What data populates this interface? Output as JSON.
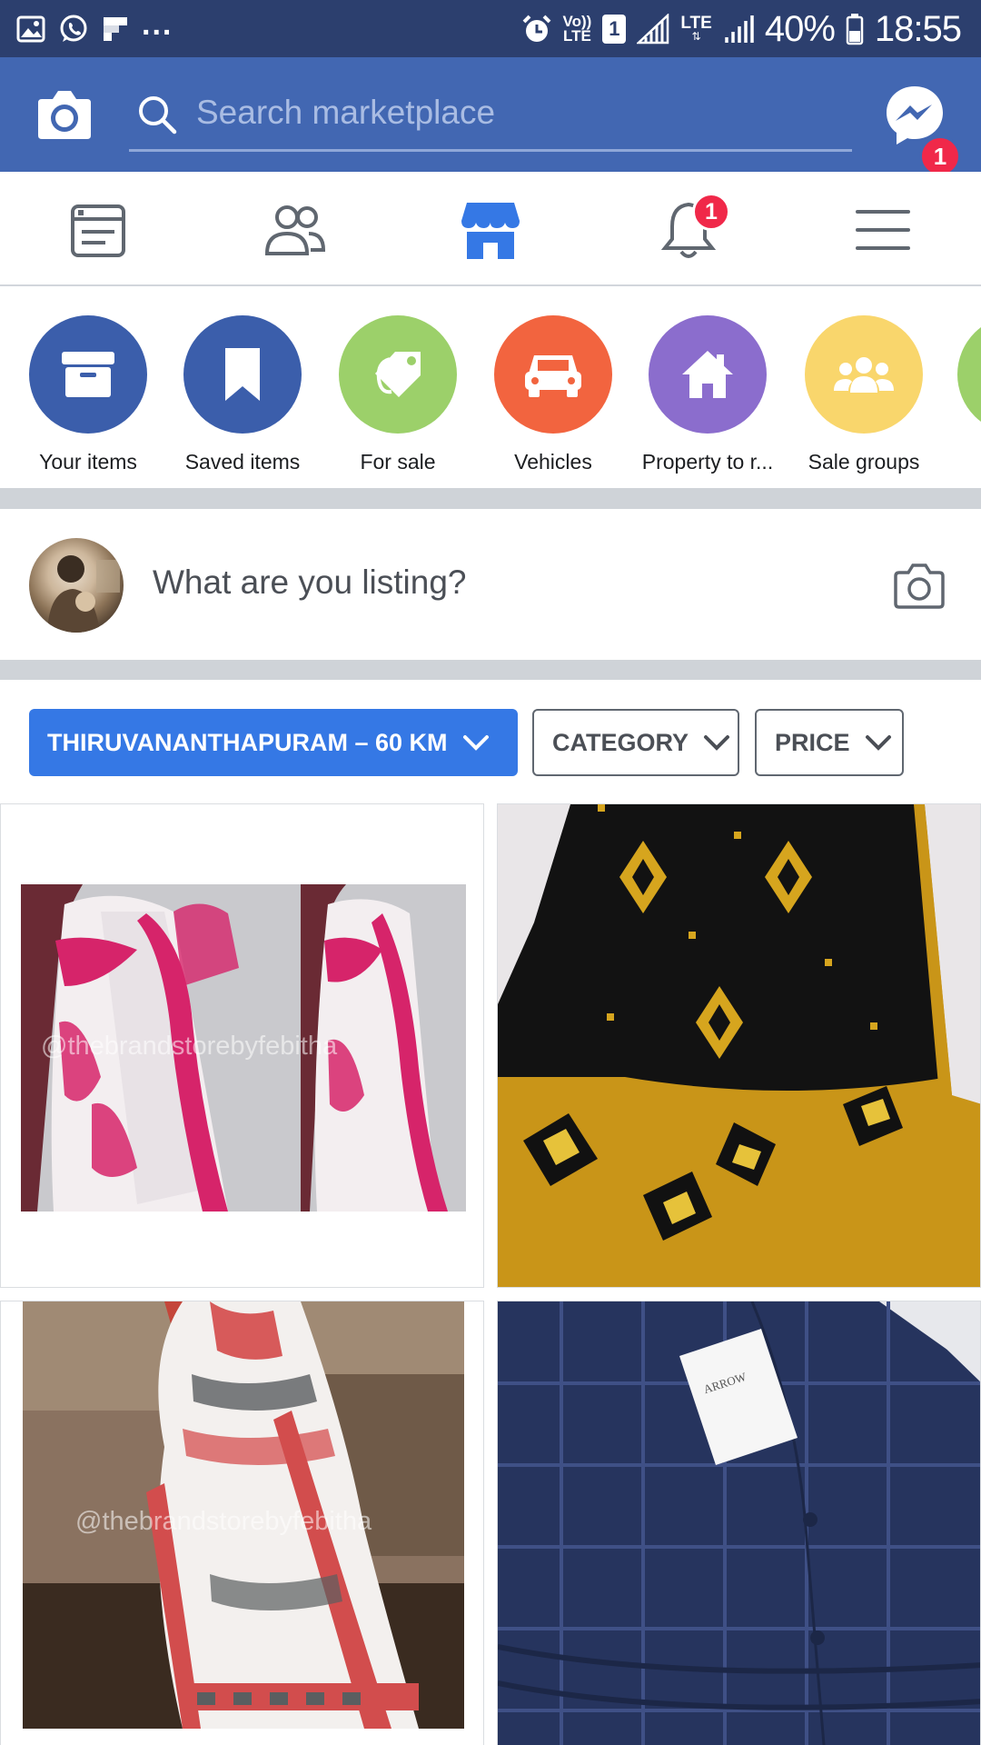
{
  "status_bar": {
    "dots": "...",
    "volte_top": "Vo))",
    "volte_bottom": "LTE",
    "sim": "1",
    "lte": "LTE",
    "battery": "40%",
    "time": "18:55"
  },
  "header": {
    "search_placeholder": "Search marketplace",
    "messenger_badge": "1"
  },
  "nav": {
    "notifications_badge": "1",
    "active_tab": "marketplace"
  },
  "shortcuts": [
    {
      "label": "Your items",
      "color": "#3b5eab",
      "icon": "archive-box-icon"
    },
    {
      "label": "Saved items",
      "color": "#3b5eab",
      "icon": "bookmark-icon"
    },
    {
      "label": "For sale",
      "color": "#9cd06a",
      "icon": "price-tag-icon"
    },
    {
      "label": "Vehicles",
      "color": "#f2643f",
      "icon": "car-icon"
    },
    {
      "label": "Property to r...",
      "color": "#8b6dcd",
      "icon": "house-icon"
    },
    {
      "label": "Sale groups",
      "color": "#f9d66c",
      "icon": "group-icon"
    }
  ],
  "composer": {
    "prompt": "What are you listing?"
  },
  "filters": {
    "location": "THIRUVANANTHAPURAM – 60 KM",
    "category": "CATEGORY",
    "price": "PRICE"
  },
  "listings": {
    "watermark": "@thebrandstorebyfebitha",
    "tag_text": "ARROW"
  },
  "colors": {
    "brand_blue": "#4267b2",
    "status_bar": "#2c3f6e",
    "accent_blue": "#3578e5",
    "badge_red": "#f02849"
  }
}
